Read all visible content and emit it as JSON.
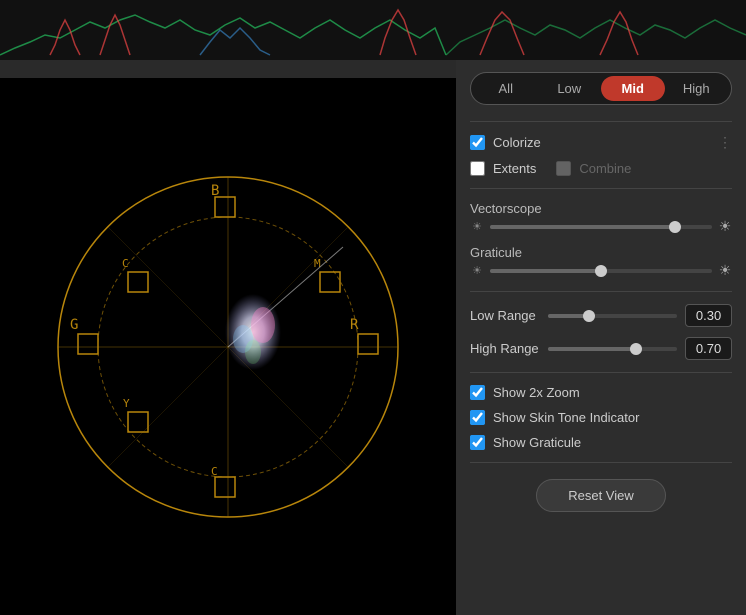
{
  "waveform": {
    "height": 60,
    "label": "waveform-display"
  },
  "tabs": {
    "items": [
      "All",
      "Low",
      "Mid",
      "High"
    ],
    "active": "Mid"
  },
  "controls": {
    "colorize": {
      "label": "Colorize",
      "checked": true
    },
    "extents": {
      "label": "Extents",
      "checked": false
    },
    "combine": {
      "label": "Combine",
      "checked": false,
      "disabled": true
    },
    "vectorscope": {
      "label": "Vectorscope",
      "value": 85
    },
    "graticule": {
      "label": "Graticule",
      "value": 50
    },
    "low_range": {
      "label": "Low Range",
      "value": 0.3,
      "display": "0.30",
      "slider_pct": 30
    },
    "high_range": {
      "label": "High Range",
      "value": 0.7,
      "display": "0.70",
      "slider_pct": 70
    },
    "show_2x_zoom": {
      "label": "Show 2x Zoom",
      "checked": true
    },
    "show_skin_tone": {
      "label": "Show Skin Tone Indicator",
      "checked": true
    },
    "show_graticule": {
      "label": "Show Graticule",
      "checked": true
    },
    "reset_button": "Reset View"
  }
}
